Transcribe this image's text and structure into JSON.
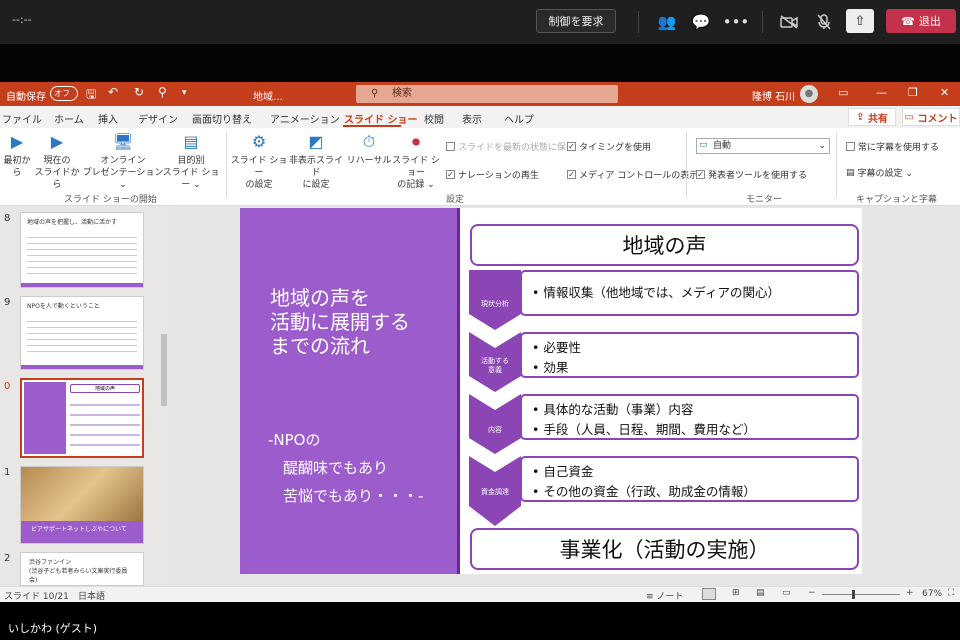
{
  "teams_bar": {
    "time": "--:--",
    "request_control": "制御を要求",
    "leave": "退出"
  },
  "titlebar": {
    "autosave": "自動保存",
    "toggle": "オフ",
    "file_name": "地域…",
    "search_placeholder": "検索",
    "user_name": "隆博 石川"
  },
  "tabs": [
    "ファイル",
    "ホーム",
    "挿入",
    "デザイン",
    "画面切り替え",
    "アニメーション",
    "スライド ショー",
    "校閲",
    "表示",
    "ヘルプ"
  ],
  "tab_active": "スライド ショー",
  "share": "共有",
  "comment": "コメント",
  "ribbon": {
    "from_start": "最初から",
    "from_current": "現在の\nスライドから",
    "online": "オンライン\nプレゼンテーション ⌄",
    "custom": "目的別\nスライド ショー ⌄",
    "group_start": "スライド ショーの開始",
    "setup": "スライド ショー\nの設定",
    "hide": "非表示スライド\nに設定",
    "rehearse": "リハーサル",
    "record": "スライド ショー\nの記録 ⌄",
    "keep_updated": "スライドを最新の状態に保つ",
    "narration": "ナレーションの再生",
    "timings": "タイミングを使用",
    "media_controls": "メディア コントロールの表示",
    "group_setup": "設定",
    "monitor_value": "自動",
    "presenter_view": "発表者ツールを使用する",
    "group_monitor": "モニター",
    "always_captions": "常に字幕を使用する",
    "caption_settings": "字幕の設定 ⌄",
    "group_captions": "キャプションと字幕"
  },
  "thumbnails": [
    {
      "num": "8",
      "title": "地域の声を把握し、活動に活かす"
    },
    {
      "num": "9",
      "title": "NPOを人で動くということ"
    },
    {
      "num": "0",
      "title": "地域の声"
    },
    {
      "num": "1",
      "caption": "ピアサポートネットしぶやについて"
    },
    {
      "num": "2",
      "title": "渋谷ファンイン\n(渋谷子ども若者みらい文庫実行委員会)"
    }
  ],
  "slide": {
    "title": "地域の声を\n活動に展開する\nまでの流れ",
    "note": "-NPOの\n　醍醐味でもあり\n　苦悩でもあり・・・-",
    "header": "地域の声",
    "footer": "事業化（活動の実施）",
    "rows": [
      {
        "label": "現状分析",
        "items": [
          "• 情報収集（他地域では、メディアの関心）"
        ]
      },
      {
        "label": "活動する\n意義",
        "items": [
          "• 必要性",
          "• 効果"
        ]
      },
      {
        "label": "内容",
        "items": [
          "• 具体的な活動（事業）内容",
          "• 手段（人員、日程、期間、費用など）"
        ]
      },
      {
        "label": "資金調達",
        "items": [
          "• 自己資金",
          "• その他の資金（行政、助成金の情報）"
        ]
      }
    ]
  },
  "statusbar": {
    "slide_info": "スライド 10/21",
    "language": "日本語",
    "notes": "ノート",
    "zoom": "67%"
  },
  "guest_name": "いしかわ (ゲスト)",
  "colors": {
    "ppt_accent": "#c43e1c",
    "slide_purple": "#9c5ccc",
    "border_purple": "#8b45b5",
    "leave_red": "#c4314b"
  }
}
